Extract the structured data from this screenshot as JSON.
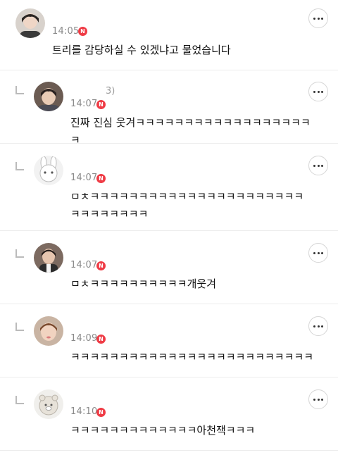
{
  "comments": [
    {
      "author": "",
      "time": "14:05",
      "badge": "N",
      "text": "트리를 감당하실 수 있겠냐고 물었습니다",
      "is_reply": false
    },
    {
      "author": "3)",
      "time": "14:07",
      "badge": "N",
      "text": "진짜 진심 웃겨ㅋㅋㅋㅋㅋㅋㅋㅋㅋㅋㅋㅋㅋㅋㅋㅋㅋㅋㅋ",
      "is_reply": true
    },
    {
      "author": "",
      "time": "14:07",
      "badge": "N",
      "text": "ㅁㅊㅋㅋㅋㅋㅋㅋㅋㅋㅋㅋㅋㅋㅋㅋㅋㅋㅋㅋㅋㅋㅋㅋㅋㅋㅋㅋㅋㅋㅋㅋ",
      "is_reply": true
    },
    {
      "author": "",
      "time": "14:07",
      "badge": "N",
      "text": "ㅁㅊㅋㅋㅋㅋㅋㅋㅋㅋㅋㅋ개웃겨",
      "is_reply": true
    },
    {
      "author": "",
      "time": "14:09",
      "badge": "N",
      "text": "ㅋㅋㅋㅋㅋㅋㅋㅋㅋㅋㅋㅋㅋㅋㅋㅋㅋㅋㅋㅋㅋㅋㅋㅋㅋ",
      "is_reply": true
    },
    {
      "author": "",
      "time": "14:10",
      "badge": "N",
      "text": "ㅋㅋㅋㅋㅋㅋㅋㅋㅋㅋㅋㅋㅋ아천잭ㅋㅋㅋ",
      "is_reply": true
    }
  ],
  "icons": {
    "more": "more-dots-icon",
    "reply": "reply-arrow-icon"
  },
  "colors": {
    "badge": "#ef3b45",
    "time": "#8a8a8a",
    "divider": "#ececec"
  }
}
